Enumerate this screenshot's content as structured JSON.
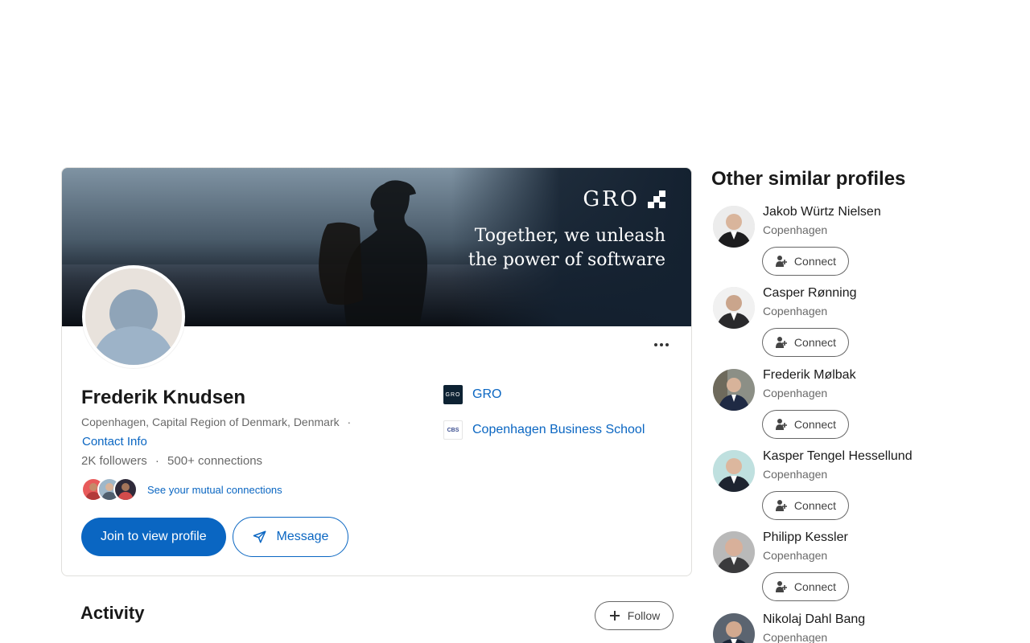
{
  "profile": {
    "banner": {
      "logo_text": "GRO",
      "tagline_line1": "Together, we unleash",
      "tagline_line2": "the power of software"
    },
    "name": "Frederik Knudsen",
    "location": "Copenhagen, Capital Region of Denmark, Denmark",
    "separator": "·",
    "contact_info": "Contact Info",
    "followers": "2K followers",
    "connections": "500+ connections",
    "mutual_link": "See your mutual connections",
    "join_label": "Join to view profile",
    "message_label": "Message",
    "orgs": [
      {
        "name": "GRO",
        "logo_text": "GRO"
      },
      {
        "name": "Copenhagen Business School",
        "logo_text": "CBS"
      }
    ]
  },
  "activity": {
    "title": "Activity",
    "follow_label": "Follow"
  },
  "similar": {
    "title": "Other similar profiles",
    "connect_label": "Connect",
    "items": [
      {
        "name": "Jakob Würtz Nielsen",
        "city": "Copenhagen"
      },
      {
        "name": "Casper Rønning",
        "city": "Copenhagen"
      },
      {
        "name": "Frederik Mølbak",
        "city": "Copenhagen"
      },
      {
        "name": "Kasper Tengel Hessellund",
        "city": "Copenhagen"
      },
      {
        "name": "Philipp Kessler",
        "city": "Copenhagen"
      },
      {
        "name": "Nikolaj Dahl Bang",
        "city": "Copenhagen"
      }
    ]
  },
  "colors": {
    "brand_blue": "#0a66c2",
    "banner_dark": "#142130"
  }
}
